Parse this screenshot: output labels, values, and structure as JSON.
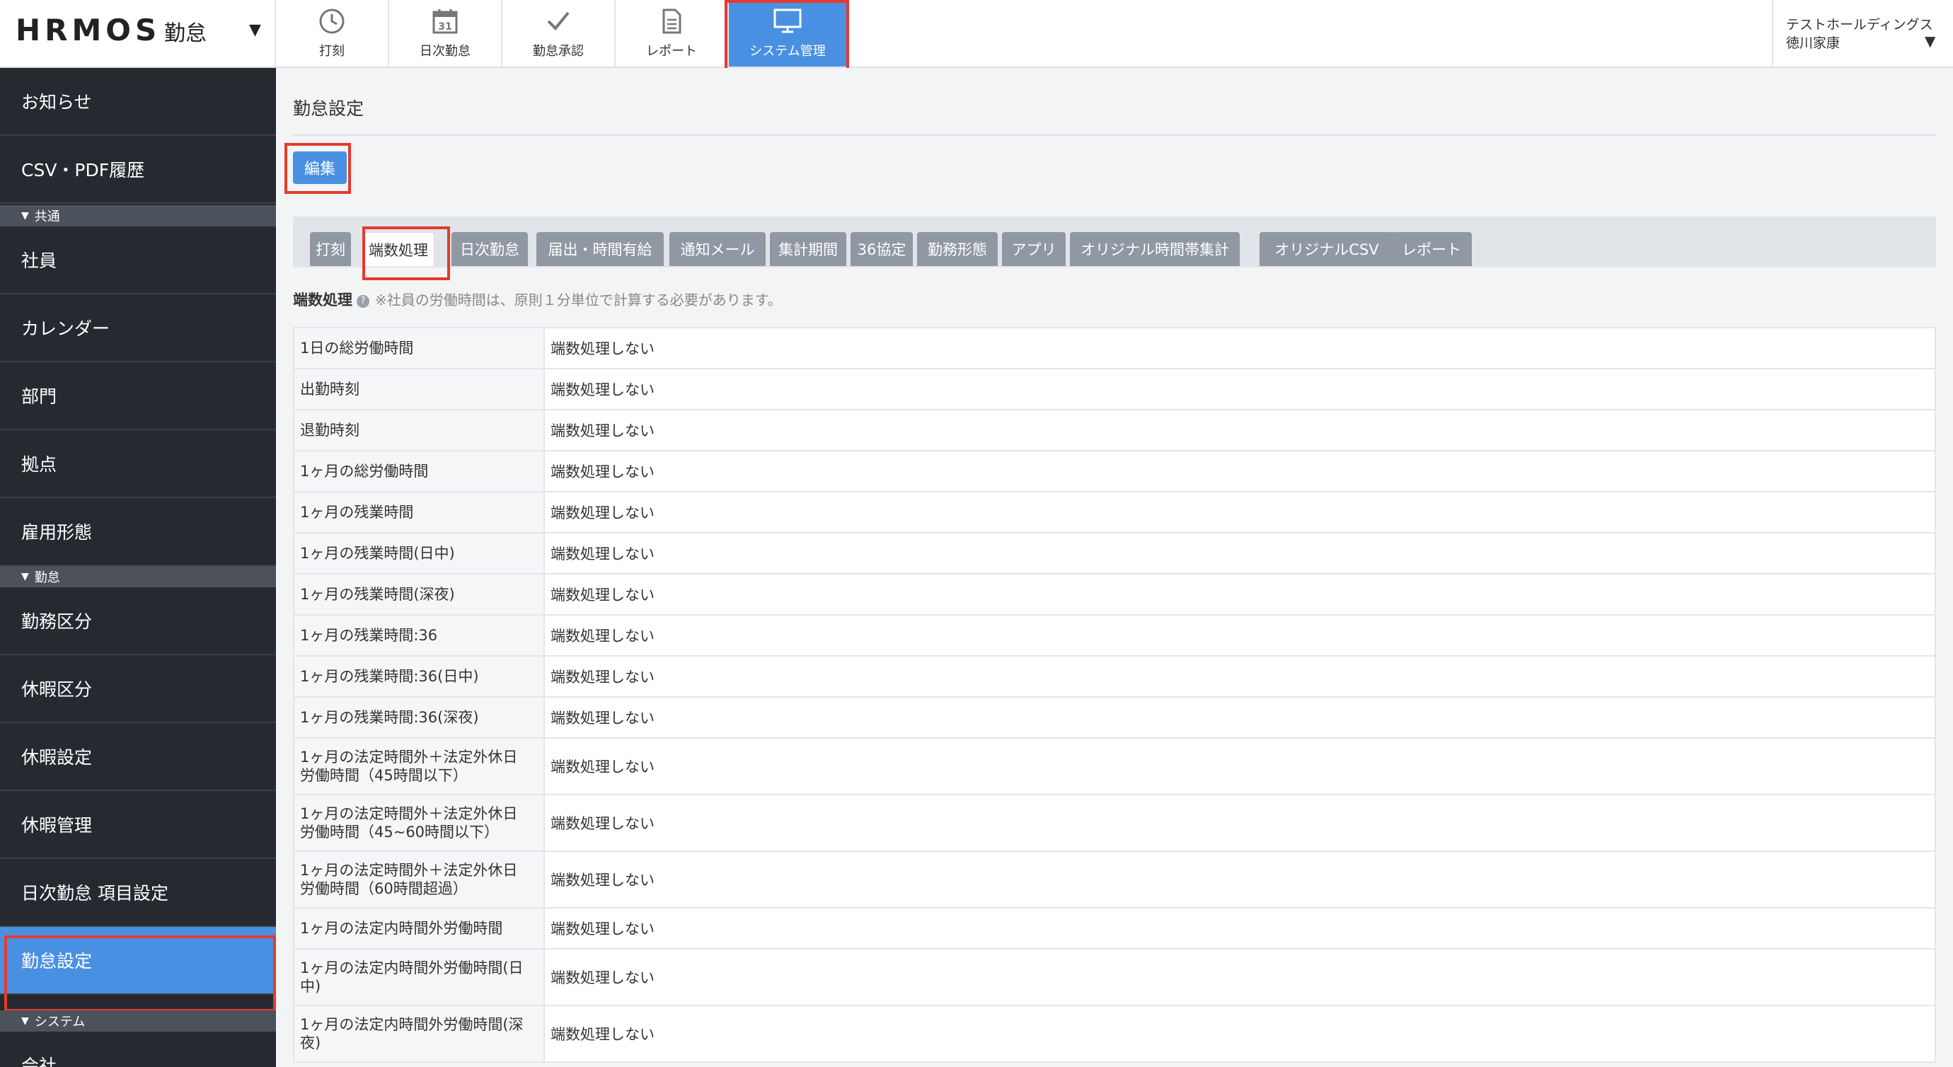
{
  "brand": {
    "logo": "HRMOS",
    "product": "勤怠"
  },
  "top_nav": [
    {
      "id": "punch",
      "label": "打刻",
      "icon": "clock-icon"
    },
    {
      "id": "daily",
      "label": "日次勤怠",
      "icon": "calendar-icon",
      "icon_text": "31"
    },
    {
      "id": "approval",
      "label": "勤怠承認",
      "icon": "check-icon"
    },
    {
      "id": "report",
      "label": "レポート",
      "icon": "document-icon"
    },
    {
      "id": "system",
      "label": "システム管理",
      "icon": "monitor-icon",
      "active": true
    }
  ],
  "user": {
    "org": "テストホールディングス",
    "name": "徳川家康"
  },
  "sidebar": {
    "top_items": [
      {
        "label": "お知らせ"
      },
      {
        "label": "CSV・PDF履歴"
      }
    ],
    "sections": [
      {
        "label": "共通",
        "items": [
          {
            "label": "社員"
          },
          {
            "label": "カレンダー"
          },
          {
            "label": "部門"
          },
          {
            "label": "拠点"
          },
          {
            "label": "雇用形態"
          }
        ]
      },
      {
        "label": "勤怠",
        "items": [
          {
            "label": "勤務区分"
          },
          {
            "label": "休暇区分"
          },
          {
            "label": "休暇設定"
          },
          {
            "label": "休暇管理"
          },
          {
            "label": "日次勤怠 項目設定"
          },
          {
            "label": "勤怠設定",
            "active": true
          }
        ]
      },
      {
        "label": "システム",
        "items": [
          {
            "label": "会社"
          }
        ]
      }
    ]
  },
  "main": {
    "title": "勤怠設定",
    "edit_label": "編集",
    "tabs": [
      {
        "label": "打刻"
      },
      {
        "label": "端数処理",
        "active": true
      },
      {
        "label": "日次勤怠"
      },
      {
        "label": "届出・時間有給"
      },
      {
        "label": "通知メール"
      },
      {
        "label": "集計期間"
      },
      {
        "label": "36協定"
      },
      {
        "label": "勤務形態"
      },
      {
        "label": "アプリ"
      },
      {
        "label": "オリジナル時間帯集計"
      },
      {
        "label": "オリジナルCSV"
      },
      {
        "label": "レポート"
      }
    ],
    "section": {
      "title": "端数処理",
      "note": "※社員の労働時間は、原則１分単位で計算する必要があります。"
    },
    "rows": [
      {
        "label": "1日の総労働時間",
        "value": "端数処理しない"
      },
      {
        "label": "出勤時刻",
        "value": "端数処理しない"
      },
      {
        "label": "退勤時刻",
        "value": "端数処理しない"
      },
      {
        "label": "1ヶ月の総労働時間",
        "value": "端数処理しない"
      },
      {
        "label": "1ヶ月の残業時間",
        "value": "端数処理しない"
      },
      {
        "label": "1ヶ月の残業時間(日中)",
        "value": "端数処理しない"
      },
      {
        "label": "1ヶ月の残業時間(深夜)",
        "value": "端数処理しない"
      },
      {
        "label": "1ヶ月の残業時間:36",
        "value": "端数処理しない"
      },
      {
        "label": "1ヶ月の残業時間:36(日中)",
        "value": "端数処理しない"
      },
      {
        "label": "1ヶ月の残業時間:36(深夜)",
        "value": "端数処理しない"
      },
      {
        "label": "1ヶ月の法定時間外＋法定外休日\n労働時間（45時間以下）",
        "value": "端数処理しない"
      },
      {
        "label": "1ヶ月の法定時間外＋法定外休日\n労働時間（45~60時間以下）",
        "value": "端数処理しない"
      },
      {
        "label": "1ヶ月の法定時間外＋法定外休日\n労働時間（60時間超過）",
        "value": "端数処理しない"
      },
      {
        "label": "1ヶ月の法定内時間外労働時間",
        "value": "端数処理しない"
      },
      {
        "label": "1ヶ月の法定内時間外労働時間(日\n中)",
        "value": "端数処理しない"
      },
      {
        "label": "1ヶ月の法定内時間外労働時間(深\n夜)",
        "value": "端数処理しない"
      }
    ]
  },
  "colors": {
    "accent": "#4a90e2",
    "highlight": "#e53a2c",
    "sidebar_bg": "#262a30",
    "section_bg": "#4b525b",
    "tab_bg": "#8f98a3"
  }
}
